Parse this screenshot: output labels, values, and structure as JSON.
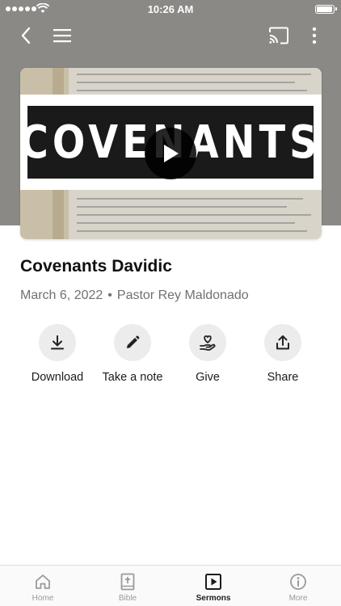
{
  "status_bar": {
    "time": "10:26 AM"
  },
  "nav": {
    "back_icon": "chevron-left-icon",
    "menu_icon": "hamburger-menu-icon",
    "cast_icon": "cast-icon",
    "more_icon": "vertical-dots-icon"
  },
  "video": {
    "title_text": "COVENANTS"
  },
  "sermon": {
    "title": "Covenants Davidic",
    "date": "March 6, 2022",
    "separator": "•",
    "speaker": "Pastor Rey Maldonado"
  },
  "actions": [
    {
      "label": "Download",
      "icon": "download-icon"
    },
    {
      "label": "Take a note",
      "icon": "pencil-icon"
    },
    {
      "label": "Give",
      "icon": "give-hand-heart-icon"
    },
    {
      "label": "Share",
      "icon": "share-icon"
    }
  ],
  "tabs": [
    {
      "label": "Home",
      "icon": "home-icon",
      "active": false
    },
    {
      "label": "Bible",
      "icon": "bible-icon",
      "active": false
    },
    {
      "label": "Sermons",
      "icon": "play-square-icon",
      "active": true
    },
    {
      "label": "More",
      "icon": "info-icon",
      "active": false
    }
  ],
  "colors": {
    "header_band": "#8a8985",
    "active_tab": "#1c1c1e",
    "inactive_tab": "#9a9a9a"
  }
}
